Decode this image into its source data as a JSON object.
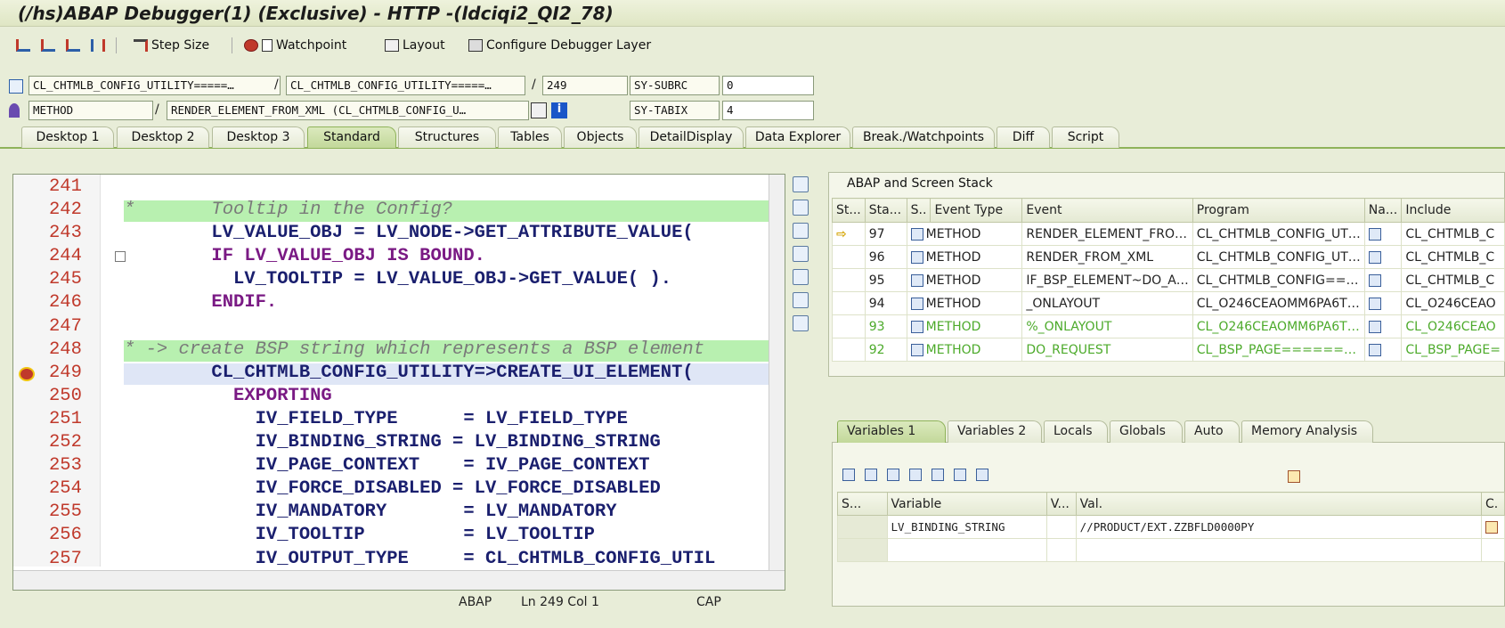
{
  "window": {
    "title": "(/hs)ABAP Debugger(1)  (Exclusive) - HTTP -(ldciqi2_QI2_78)"
  },
  "toolbar": {
    "step_size": "Step Size",
    "watchpoint": "Watchpoint",
    "layout": "Layout",
    "configure": "Configure Debugger Layer"
  },
  "context": {
    "program1": "CL_CHTMLB_CONFIG_UTILITY=====…",
    "program2": "CL_CHTMLB_CONFIG_UTILITY=====…",
    "line": "249",
    "sy_subrc_label": "SY-SUBRC",
    "sy_subrc": "0",
    "event_type": "METHOD",
    "event": "RENDER_ELEMENT_FROM_XML (CL_CHTMLB_CONFIG_U…",
    "sy_tabix_label": "SY-TABIX",
    "sy_tabix": "4"
  },
  "tabs": [
    "Desktop 1",
    "Desktop 2",
    "Desktop 3",
    "Standard",
    "Structures",
    "Tables",
    "Objects",
    "DetailDisplay",
    "Data Explorer",
    "Break./Watchpoints",
    "Diff",
    "Script"
  ],
  "code": [
    {
      "n": "241",
      "t": ""
    },
    {
      "n": "242",
      "t": "*       Tooltip in the Config?"
    },
    {
      "n": "243",
      "t": "        LV_VALUE_OBJ = LV_NODE->GET_ATTRIBUTE_VALUE("
    },
    {
      "n": "244",
      "t": "        IF LV_VALUE_OBJ IS BOUND."
    },
    {
      "n": "245",
      "t": "          LV_TOOLTIP = LV_VALUE_OBJ->GET_VALUE( )."
    },
    {
      "n": "246",
      "t": "        ENDIF."
    },
    {
      "n": "247",
      "t": ""
    },
    {
      "n": "248",
      "t": "* -> create BSP string which represents a BSP element"
    },
    {
      "n": "249",
      "t": "        CL_CHTMLB_CONFIG_UTILITY=>CREATE_UI_ELEMENT("
    },
    {
      "n": "250",
      "t": "          EXPORTING"
    },
    {
      "n": "251",
      "t": "            IV_FIELD_TYPE      = LV_FIELD_TYPE"
    },
    {
      "n": "252",
      "t": "            IV_BINDING_STRING = LV_BINDING_STRING"
    },
    {
      "n": "253",
      "t": "            IV_PAGE_CONTEXT    = IV_PAGE_CONTEXT"
    },
    {
      "n": "254",
      "t": "            IV_FORCE_DISABLED = LV_FORCE_DISABLED"
    },
    {
      "n": "255",
      "t": "            IV_MANDATORY       = LV_MANDATORY"
    },
    {
      "n": "256",
      "t": "            IV_TOOLTIP         = LV_TOOLTIP"
    },
    {
      "n": "257",
      "t": "            IV_OUTPUT_TYPE     = CL_CHTMLB_CONFIG_UTIL"
    }
  ],
  "status": {
    "lang": "ABAP",
    "pos": "Ln 249 Col  1",
    "caps": "CAP"
  },
  "stack": {
    "title": "ABAP and Screen Stack",
    "headers": [
      "St...",
      "Sta...",
      "S..",
      "Event Type",
      "Event",
      "Program",
      "Na...",
      "Include"
    ],
    "rows": [
      {
        "sta": "97",
        "type": "METHOD",
        "event": "RENDER_ELEMENT_FRO…",
        "program": "CL_CHTMLB_CONFIG_UT…",
        "include": "CL_CHTMLB_C",
        "current": true
      },
      {
        "sta": "96",
        "type": "METHOD",
        "event": "RENDER_FROM_XML",
        "program": "CL_CHTMLB_CONFIG_UT…",
        "include": "CL_CHTMLB_C"
      },
      {
        "sta": "95",
        "type": "METHOD",
        "event": "IF_BSP_ELEMENT~DO_A…",
        "program": "CL_CHTMLB_CONFIG==…",
        "include": "CL_CHTMLB_C"
      },
      {
        "sta": "94",
        "type": "METHOD",
        "event": "_ONLAYOUT",
        "program": "CL_O246CEAOMM6PA6T…",
        "include": "CL_O246CEAO"
      },
      {
        "sta": "93",
        "type": "METHOD",
        "event": "%_ONLAYOUT",
        "program": "CL_O246CEAOMM6PA6T…",
        "include": "CL_O246CEAO",
        "grey": true
      },
      {
        "sta": "92",
        "type": "METHOD",
        "event": "DO_REQUEST",
        "program": "CL_BSP_PAGE======…",
        "include": "CL_BSP_PAGE=",
        "grey": true
      }
    ]
  },
  "var_tabs": [
    "Variables 1",
    "Variables 2",
    "Locals",
    "Globals",
    "Auto",
    "Memory Analysis"
  ],
  "vars": {
    "headers": [
      "S...",
      "Variable",
      "V...",
      "Val.",
      "C."
    ],
    "rows": [
      {
        "name": "LV_BINDING_STRING",
        "val": "//PRODUCT/EXT.ZZBFLD0000PY"
      }
    ]
  }
}
